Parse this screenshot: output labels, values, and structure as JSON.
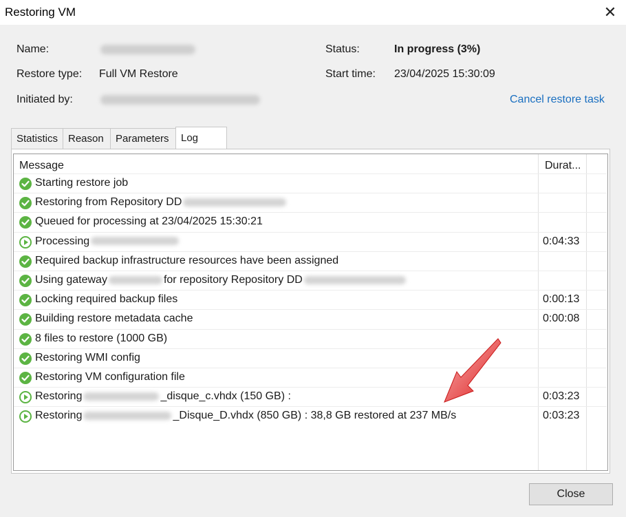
{
  "window": {
    "title": "Restoring VM"
  },
  "info": {
    "name_label": "Name:",
    "restore_type_label": "Restore type:",
    "restore_type_value": "Full VM Restore",
    "initiated_by_label": "Initiated by:",
    "status_label": "Status:",
    "status_value": "In progress (3%)",
    "start_time_label": "Start time:",
    "start_time_value": "23/04/2025 15:30:09",
    "cancel_link": "Cancel restore task"
  },
  "tabs": [
    {
      "label": "Statistics"
    },
    {
      "label": "Reason"
    },
    {
      "label": "Parameters"
    },
    {
      "label": "Log"
    }
  ],
  "log": {
    "col_message": "Message",
    "col_duration": "Durat...",
    "rows": [
      {
        "status": "success",
        "before": "Starting restore job",
        "after": "",
        "duration": ""
      },
      {
        "status": "success",
        "before": "Restoring from Repository DD",
        "after": "",
        "duration": ""
      },
      {
        "status": "success",
        "before": "Queued for processing at 23/04/2025 15:30:21",
        "after": "",
        "duration": ""
      },
      {
        "status": "running",
        "before": "Processing",
        "after": "",
        "duration": "0:04:33"
      },
      {
        "status": "success",
        "before": "Required backup infrastructure resources have been assigned",
        "after": "",
        "duration": ""
      },
      {
        "status": "success",
        "before": "Using gateway",
        "after": "for repository Repository DD",
        "duration": ""
      },
      {
        "status": "success",
        "before": "Locking required backup files",
        "after": "",
        "duration": "0:00:13"
      },
      {
        "status": "success",
        "before": "Building restore metadata cache",
        "after": "",
        "duration": "0:00:08"
      },
      {
        "status": "success",
        "before": "8 files to restore (1000 GB)",
        "after": "",
        "duration": ""
      },
      {
        "status": "success",
        "before": "Restoring WMI config",
        "after": "",
        "duration": ""
      },
      {
        "status": "success",
        "before": "Restoring VM configuration file",
        "after": "",
        "duration": ""
      },
      {
        "status": "running",
        "before": "Restoring",
        "after": "_disque_c.vhdx (150 GB) :",
        "duration": "0:03:23"
      },
      {
        "status": "running",
        "before": "Restoring",
        "after": "_Disque_D.vhdx (850 GB) : 38,8 GB restored at 237 MB/s",
        "duration": "0:03:23"
      }
    ]
  },
  "buttons": {
    "close": "Close"
  },
  "colors": {
    "success": "#5cb443",
    "running": "#5cb443",
    "link": "#1a6fc0",
    "arrow": "#e01e1e"
  },
  "icons": {
    "success": "check-circle-icon",
    "running": "play-circle-icon",
    "close": "close-icon"
  }
}
